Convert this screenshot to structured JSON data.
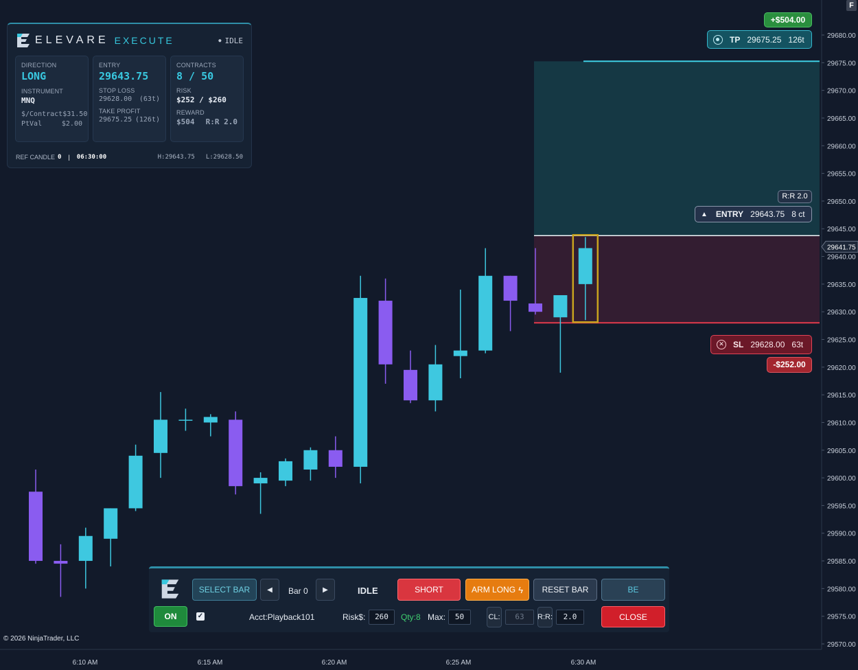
{
  "colors": {
    "background": "#121a2a",
    "bull": "#3ec8e0",
    "bear": "#8a5cf0",
    "tp_zone": "#17434d",
    "sl_zone": "#3a1f33",
    "accent": "#36c6dc"
  },
  "brand": {
    "name": "ELEVARE",
    "sub": "EXECUTE",
    "logo_icon": "elevare-e-logo"
  },
  "panel": {
    "state": "IDLE",
    "direction_label": "DIRECTION",
    "direction": "LONG",
    "instrument_label": "INSTRUMENT",
    "instrument": "MNQ",
    "per_contract_label": "$/Contract",
    "per_contract": "$31.50",
    "ptval_label": "PtVal",
    "ptval": "$2.00",
    "entry_label": "ENTRY",
    "entry": "29643.75",
    "stop_label": "STOP LOSS",
    "stop": "29628.00",
    "stop_ticks": "(63t)",
    "tp_label": "TAKE PROFIT",
    "tp": "29675.25",
    "tp_ticks": "(126t)",
    "contracts_label": "CONTRACTS",
    "contracts": "8 / 50",
    "risk_label": "RISK",
    "risk": "$252 / $260",
    "reward_label": "REWARD",
    "reward": "$504",
    "rr": "R:R 2.0",
    "ref_candle_label": "REF CANDLE",
    "ref_candle": "0",
    "ref_time": "06:30:00",
    "ref_high": "H:29643.75",
    "ref_low": "L:29628.50"
  },
  "tags": {
    "tp_pnl": "+$504.00",
    "tp_key": "TP",
    "tp_price": "29675.25",
    "tp_ticks": "126t",
    "rr": "R:R 2.0",
    "entry_key": "ENTRY",
    "entry_price": "29643.75",
    "entry_qty": "8 ct",
    "last_price": "29641.75",
    "sl_key": "SL",
    "sl_price": "29628.00",
    "sl_ticks": "63t",
    "sl_pnl": "-$252.00"
  },
  "toolbar": {
    "select_bar": "SELECT BAR",
    "bar": "Bar 0",
    "status": "IDLE",
    "short": "SHORT",
    "arm_long": "ARM LONG",
    "reset_bar": "RESET BAR",
    "be": "BE",
    "on": "ON",
    "account": "Acct:Playback101",
    "risk_label": "Risk$:",
    "risk_value": "260",
    "qty": "Qty:8",
    "max_label": "Max:",
    "max_value": "50",
    "cl_label": "CL:",
    "cl_value": "63",
    "rr_label": "R:R:",
    "rr_value": "2.0",
    "close": "CLOSE"
  },
  "copyright": "© 2026 NinjaTrader, LLC",
  "f_button": "F",
  "chart_data": {
    "type": "candlestick",
    "y_axis_ticks": [
      29680,
      29675,
      29670,
      29665,
      29660,
      29655,
      29650,
      29645,
      29640,
      29635,
      29630,
      29625,
      29620,
      29615,
      29610,
      29605,
      29600,
      29595,
      29590,
      29585,
      29580,
      29575,
      29570
    ],
    "y_tick_labels": [
      "29680.00",
      "29675.00",
      "29670.00",
      "29665.00",
      "29660.00",
      "29655.00",
      "29650.00",
      "29645.00",
      "29640.00",
      "29635.00",
      "29630.00",
      "29625.00",
      "29620.00",
      "29615.00",
      "29610.00",
      "29605.00",
      "29600.00",
      "29595.00",
      "29590.00",
      "29585.00",
      "29580.00",
      "29575.00",
      "29570.00"
    ],
    "x_tick_labels": [
      "6:10 AM",
      "6:15 AM",
      "6:20 AM",
      "6:25 AM",
      "6:30 AM"
    ],
    "candles": [
      {
        "o": 29597.5,
        "h": 29601.5,
        "l": 29584.5,
        "c": 29585.0
      },
      {
        "o": 29585.0,
        "h": 29588.0,
        "l": 29578.5,
        "c": 29584.5
      },
      {
        "o": 29585.0,
        "h": 29591.0,
        "l": 29580.0,
        "c": 29589.5
      },
      {
        "o": 29589.0,
        "h": 29594.5,
        "l": 29584.0,
        "c": 29594.5
      },
      {
        "o": 29594.5,
        "h": 29606.0,
        "l": 29594.0,
        "c": 29604.0
      },
      {
        "o": 29604.5,
        "h": 29615.5,
        "l": 29600.0,
        "c": 29610.5
      },
      {
        "o": 29610.5,
        "h": 29612.5,
        "l": 29608.5,
        "c": 29610.5
      },
      {
        "o": 29610.0,
        "h": 29611.5,
        "l": 29607.5,
        "c": 29611.0
      },
      {
        "o": 29610.5,
        "h": 29612.0,
        "l": 29597.0,
        "c": 29598.5
      },
      {
        "o": 29599.0,
        "h": 29601.0,
        "l": 29593.5,
        "c": 29600.0
      },
      {
        "o": 29599.5,
        "h": 29603.5,
        "l": 29598.5,
        "c": 29603.0
      },
      {
        "o": 29601.5,
        "h": 29605.5,
        "l": 29599.5,
        "c": 29605.0
      },
      {
        "o": 29605.0,
        "h": 29607.5,
        "l": 29600.0,
        "c": 29602.0
      },
      {
        "o": 29602.0,
        "h": 29636.5,
        "l": 29599.0,
        "c": 29632.5
      },
      {
        "o": 29632.0,
        "h": 29636.0,
        "l": 29617.0,
        "c": 29620.5
      },
      {
        "o": 29619.5,
        "h": 29623.0,
        "l": 29613.5,
        "c": 29614.0
      },
      {
        "o": 29614.0,
        "h": 29624.0,
        "l": 29612.0,
        "c": 29620.5
      },
      {
        "o": 29622.0,
        "h": 29634.0,
        "l": 29618.0,
        "c": 29623.0
      },
      {
        "o": 29623.0,
        "h": 29641.5,
        "l": 29622.5,
        "c": 29636.5
      },
      {
        "o": 29636.5,
        "h": 29636.5,
        "l": 29626.5,
        "c": 29632.0
      },
      {
        "o": 29631.5,
        "h": 29641.5,
        "l": 29629.5,
        "c": 29630.0
      },
      {
        "o": 29629.0,
        "h": 29633.0,
        "l": 29619.0,
        "c": 29633.0
      },
      {
        "o": 29635.0,
        "h": 29643.5,
        "l": 29628.5,
        "c": 29641.5
      }
    ],
    "levels": {
      "tp": 29675.25,
      "entry": 29643.75,
      "sl": 29628.0,
      "last": 29641.75
    }
  }
}
